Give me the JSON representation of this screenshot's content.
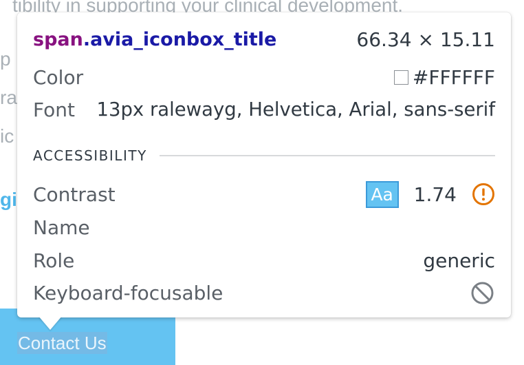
{
  "background": {
    "top_text": "tibility in supporting your clinical development.",
    "left_fragments": [
      "p",
      "ra",
      "ic"
    ],
    "link_fragment": "gi",
    "contact_label": "Contact Us"
  },
  "inspect": {
    "tag": "span",
    "class": ".avia_iconbox_title",
    "dimensions": "66.34 × 15.11",
    "color_label": "Color",
    "color_value": "#FFFFFF",
    "font_label": "Font",
    "font_value": "13px ralewayg, Helvetica, Arial, sans-serif",
    "accessibility_heading": "ACCESSIBILITY",
    "contrast_label": "Contrast",
    "contrast_sample": "Aa",
    "contrast_ratio": "1.74",
    "name_label": "Name",
    "role_label": "Role",
    "role_value": "generic",
    "keyboard_label": "Keyboard-focusable"
  },
  "icons": {
    "warning": "warning-circle-icon",
    "keyboard": "not-allowed-icon"
  },
  "colors": {
    "swatch": "#FFFFFF",
    "contrast_badge_bg": "#64C3F2",
    "warning": "#E37400",
    "tag_name": "#881280",
    "class_name": "#1A1AA6"
  }
}
